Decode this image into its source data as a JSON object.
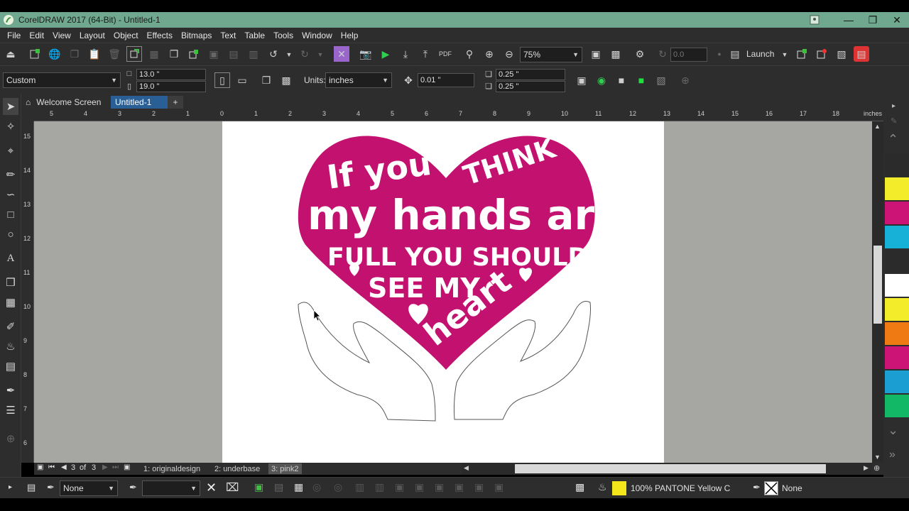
{
  "window": {
    "title": "CorelDRAW 2017 (64-Bit) - Untitled-1",
    "controls": [
      "minimize-icon",
      "maximize-icon",
      "close-icon"
    ]
  },
  "menu": [
    "File",
    "Edit",
    "View",
    "Layout",
    "Object",
    "Effects",
    "Bitmaps",
    "Text",
    "Table",
    "Tools",
    "Window",
    "Help"
  ],
  "toolbar": {
    "zoom": "75%",
    "rotation": "0.0",
    "launch_label": "Launch"
  },
  "property_bar": {
    "page_size": "Custom",
    "width": "13.0 \"",
    "height": "19.0 \"",
    "units_label": "Units:",
    "units_value": "inches",
    "nudge": "0.01 \"",
    "dup_x": "0.25 \"",
    "dup_y": "0.25 \""
  },
  "doc_tabs": {
    "welcome": "Welcome Screen",
    "document": "Untitled-1"
  },
  "ruler": {
    "unit": "inches",
    "h_ticks": [
      "5",
      "4",
      "3",
      "2",
      "1",
      "0",
      "1",
      "2",
      "3",
      "4",
      "5",
      "6",
      "7",
      "8",
      "9",
      "10",
      "11",
      "12",
      "13",
      "14",
      "15",
      "16",
      "17",
      "18"
    ],
    "v_ticks": [
      "15",
      "14",
      "13",
      "12",
      "11",
      "10",
      "9",
      "8",
      "7",
      "6"
    ]
  },
  "artwork": {
    "lines": [
      "If you",
      "THINK",
      "my hands are",
      "FULL YOU SHOULD",
      "SEE MY",
      "heart"
    ],
    "heart_color": "#c3116f"
  },
  "page_nav": {
    "current": "3",
    "of_label": "of",
    "total": "3",
    "pages": [
      "1: originaldesign",
      "2: underbase",
      "3: pink2"
    ]
  },
  "status": {
    "fill_none": "None",
    "fill_color_label": "100% PANTONE Yellow C",
    "outline_none": "None",
    "fill_swatch": "#f5e61b"
  },
  "palette_colors": [
    "#2b2b2b",
    "#f2ec2a",
    "#cc1477",
    "#17b0d6",
    "#2b2b2b",
    "#ffffff",
    "#f2ec2a",
    "#ef7a13",
    "#cc1477",
    "#1b9fd3",
    "#12b866"
  ]
}
